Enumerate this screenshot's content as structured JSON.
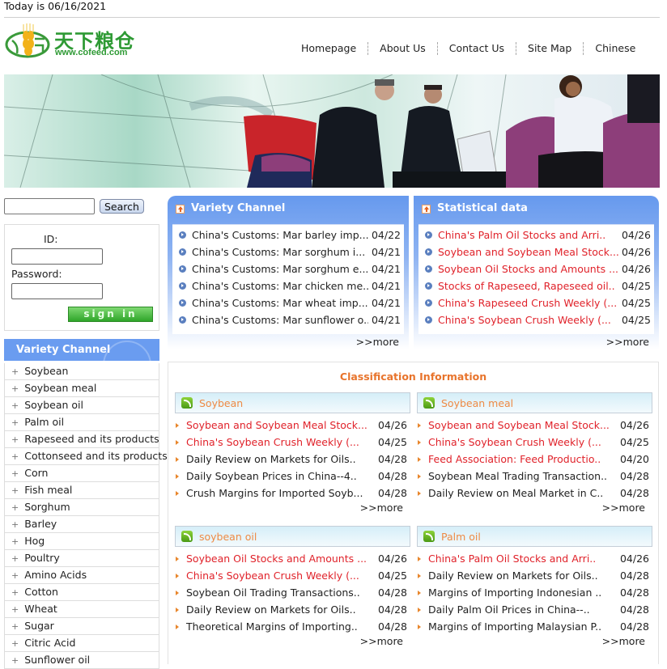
{
  "header": {
    "today": "Today is 06/16/2021",
    "logo_cn": "天下粮仓",
    "logo_url": "www.cofeed.com",
    "nav": [
      "Homepage",
      "About Us",
      "Contact Us",
      "Site Map",
      "Chinese"
    ]
  },
  "search": {
    "placeholder": "",
    "value": "",
    "button": "Search"
  },
  "login": {
    "id_label": "ID:",
    "password_label": "Password:",
    "sign_in": "sign in"
  },
  "sidebar": {
    "title": "Variety Channel",
    "items": [
      "Soybean",
      "Soybean meal",
      "Soybean oil",
      "Palm oil",
      "Rapeseed and its products",
      "Cottonseed and its products",
      "Corn",
      "Fish meal",
      "Sorghum",
      "Barley",
      "Hog",
      "Poultry",
      "Amino Acids",
      "Cotton",
      "Wheat",
      "Sugar",
      "Citric Acid",
      "Sunflower oil"
    ]
  },
  "variety_panel": {
    "title": "Variety Channel",
    "more": ">>more",
    "items": [
      {
        "title": "China's Customs: Mar barley imp...",
        "date": "04/22",
        "hot": false
      },
      {
        "title": "China's Customs: Mar sorghum i...",
        "date": "04/21",
        "hot": false
      },
      {
        "title": "China's Customs: Mar sorghum e...",
        "date": "04/21",
        "hot": false
      },
      {
        "title": "China's Customs: Mar chicken me...",
        "date": "04/21",
        "hot": false
      },
      {
        "title": "China's Customs: Mar wheat imp...",
        "date": "04/21",
        "hot": false
      },
      {
        "title": "China's Customs: Mar sunflower o..",
        "date": "04/21",
        "hot": false
      }
    ]
  },
  "stats_panel": {
    "title": "Statistical data",
    "more": ">>more",
    "items": [
      {
        "title": "China's Palm Oil Stocks and Arri..",
        "date": "04/26",
        "hot": true
      },
      {
        "title": "Soybean and Soybean Meal Stock...",
        "date": "04/26",
        "hot": true
      },
      {
        "title": "Soybean Oil Stocks and Amounts ...",
        "date": "04/26",
        "hot": true
      },
      {
        "title": "Stocks of Rapeseed, Rapeseed oil..",
        "date": "04/25",
        "hot": true
      },
      {
        "title": "China's Rapeseed Crush Weekly (...",
        "date": "04/25",
        "hot": true
      },
      {
        "title": "China's Soybean Crush Weekly (...",
        "date": "04/25",
        "hot": true
      }
    ]
  },
  "classification": {
    "title": "Classification Information",
    "boxes": [
      {
        "name": "Soybean",
        "more": ">>more",
        "items": [
          {
            "title": "Soybean and Soybean Meal Stock...",
            "date": "04/26",
            "hot": true
          },
          {
            "title": "China's Soybean Crush Weekly (...",
            "date": "04/25",
            "hot": true
          },
          {
            "title": "Daily Review on Markets for Oils..",
            "date": "04/28",
            "hot": false
          },
          {
            "title": "Daily Soybean Prices in China--4..",
            "date": "04/28",
            "hot": false
          },
          {
            "title": "Crush Margins for Imported Soyb...",
            "date": "04/28",
            "hot": false
          }
        ]
      },
      {
        "name": "Soybean meal",
        "more": ">>more",
        "items": [
          {
            "title": "Soybean and Soybean Meal Stock...",
            "date": "04/26",
            "hot": true
          },
          {
            "title": "China's Soybean Crush Weekly (...",
            "date": "04/25",
            "hot": true
          },
          {
            "title": "Feed Association: Feed Productio..",
            "date": "04/20",
            "hot": true
          },
          {
            "title": "Soybean Meal Trading Transaction..",
            "date": "04/28",
            "hot": false
          },
          {
            "title": "Daily Review on Meal Market in C..",
            "date": "04/28",
            "hot": false
          }
        ]
      },
      {
        "name": "soybean oil",
        "more": ">>more",
        "items": [
          {
            "title": "Soybean Oil Stocks and Amounts ...",
            "date": "04/26",
            "hot": true
          },
          {
            "title": "China's Soybean Crush Weekly (...",
            "date": "04/25",
            "hot": true
          },
          {
            "title": "Soybean Oil Trading Transactions..",
            "date": "04/28",
            "hot": false
          },
          {
            "title": "Daily Review on Markets for Oils..",
            "date": "04/28",
            "hot": false
          },
          {
            "title": "Theoretical Margins of Importing..",
            "date": "04/28",
            "hot": false
          }
        ]
      },
      {
        "name": "Palm oil",
        "more": ">>more",
        "items": [
          {
            "title": "China's Palm Oil Stocks and Arri..",
            "date": "04/26",
            "hot": true
          },
          {
            "title": "Daily Review on Markets for Oils..",
            "date": "04/28",
            "hot": false
          },
          {
            "title": "Margins of Importing Indonesian ..",
            "date": "04/28",
            "hot": false
          },
          {
            "title": "Daily Palm Oil Prices in China--..",
            "date": "04/28",
            "hot": false
          },
          {
            "title": "Margins of Importing Malaysian P..",
            "date": "04/28",
            "hot": false
          }
        ]
      }
    ]
  },
  "colors": {
    "accent_blue": "#6699ee",
    "hot_red": "#e0222a",
    "orange": "#e8742c",
    "logo_green": "#2e9a34"
  }
}
